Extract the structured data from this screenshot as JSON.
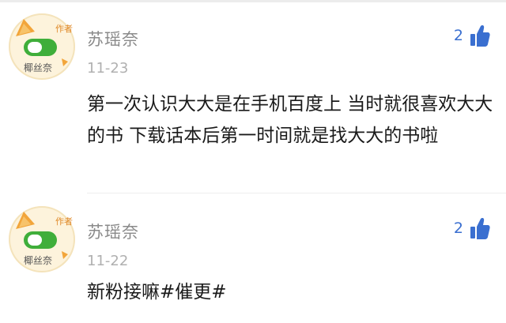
{
  "comments": [
    {
      "username": "苏瑶奈",
      "date": "11-23",
      "text": "第一次认识大大是在手机百度上 当时就很喜欢大大的书 下载话本后第一时间就是找大大的书啦",
      "like_count": "2",
      "avatar_badge": "作者",
      "avatar_caption": "椰丝奈"
    },
    {
      "username": "苏瑶奈",
      "date": "11-22",
      "text": "新粉接嘛#催更#",
      "like_count": "2",
      "avatar_badge": "作者",
      "avatar_caption": "椰丝奈"
    }
  ],
  "colors": {
    "accent_blue": "#3a6fd0",
    "username_gray": "#8a8a8a",
    "date_gray": "#b0b0b0",
    "avatar_orange": "#f2a53a",
    "avatar_green": "#3fae3a"
  },
  "icons": [
    "thumbs-up-icon",
    "avatar-image"
  ]
}
